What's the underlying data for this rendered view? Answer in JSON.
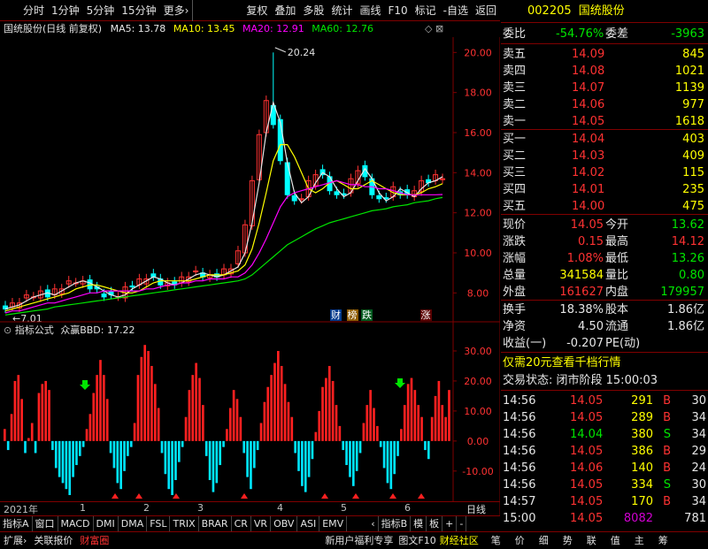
{
  "toolbar": {
    "items": [
      "分时",
      "1分钟",
      "5分钟",
      "15分钟",
      "更多›",
      "复权",
      "叠加",
      "多股",
      "统计",
      "画线",
      "F10",
      "标记",
      "-自选",
      "返回"
    ]
  },
  "main_chart": {
    "title": "国统股份(日线 前复权)",
    "ma5": "MA5: 13.78",
    "ma10": "MA10: 13.45",
    "ma20": "MA20: 12.91",
    "ma60": "MA60: 12.76",
    "y_ticks": [
      "20.00",
      "18.00",
      "16.00",
      "14.00",
      "12.00",
      "10.00",
      "8.00"
    ],
    "high_label": "20.24",
    "low_label": "7.01",
    "markers": [
      "财",
      "榜",
      "跌",
      "涨"
    ]
  },
  "indicator": {
    "name": "指标公式",
    "formula": "众赢BBD: 17.22",
    "y_ticks": [
      "30.00",
      "20.00",
      "10.00",
      "0.00",
      "-10.00"
    ]
  },
  "timeline": {
    "year": "2021年",
    "months": [
      "1",
      "2",
      "3",
      "4",
      "5",
      "6"
    ],
    "right": "日线"
  },
  "bottom_tabs": [
    "指标A",
    "窗口",
    "MACD",
    "DMI",
    "DMA",
    "FSL",
    "TRIX",
    "BRAR",
    "CR",
    "VR",
    "OBV",
    "ASI",
    "EMV",
    "‹",
    "指标B",
    "模",
    "板",
    "+",
    "-"
  ],
  "status_left": [
    "扩展›",
    "关联报价",
    "财富圈"
  ],
  "status_mid": [
    "新用户福利专享",
    "图文F10",
    "财经社区"
  ],
  "status_right": [
    "笔",
    "价",
    "细",
    "势",
    "联",
    "值",
    "主",
    "筹"
  ],
  "quote": {
    "code": "002205",
    "name": "国统股份",
    "weibi_label": "委比",
    "weibi": "-54.76%",
    "weicha_label": "委差",
    "weicha": "-3963",
    "asks": [
      {
        "label": "卖五",
        "price": "14.09",
        "vol": "845"
      },
      {
        "label": "卖四",
        "price": "14.08",
        "vol": "1021"
      },
      {
        "label": "卖三",
        "price": "14.07",
        "vol": "1139"
      },
      {
        "label": "卖二",
        "price": "14.06",
        "vol": "977"
      },
      {
        "label": "卖一",
        "price": "14.05",
        "vol": "1618"
      }
    ],
    "bids": [
      {
        "label": "买一",
        "price": "14.04",
        "vol": "403"
      },
      {
        "label": "买二",
        "price": "14.03",
        "vol": "409"
      },
      {
        "label": "买三",
        "price": "14.02",
        "vol": "115"
      },
      {
        "label": "买四",
        "price": "14.01",
        "vol": "235"
      },
      {
        "label": "买五",
        "price": "14.00",
        "vol": "475"
      }
    ],
    "stats": [
      {
        "l1": "现价",
        "v1": "14.05",
        "l2": "今开",
        "v2": "13.62"
      },
      {
        "l1": "涨跌",
        "v1": "0.15",
        "l2": "最高",
        "v2": "14.12"
      },
      {
        "l1": "涨幅",
        "v1": "1.08%",
        "l2": "最低",
        "v2": "13.26"
      },
      {
        "l1": "总量",
        "v1": "341584",
        "l2": "量比",
        "v2": "0.80"
      },
      {
        "l1": "外盘",
        "v1": "161627",
        "l2": "内盘",
        "v2": "179957"
      }
    ],
    "stats2": [
      {
        "l1": "换手",
        "v1": "18.38%",
        "l2": "股本",
        "v2": "1.86亿"
      },
      {
        "l1": "净资",
        "v1": "4.50",
        "l2": "流通",
        "v2": "1.86亿"
      },
      {
        "l1": "收益(一)",
        "v1": "-0.207",
        "l2": "PE(动)",
        "v2": ""
      }
    ],
    "promo": "仅需20元查看千档行情",
    "trade_status": "交易状态: 闭市阶段 15:00:03",
    "ticks": [
      {
        "t": "14:56",
        "p": "14.05",
        "v": "291",
        "d": "B",
        "n": "30"
      },
      {
        "t": "14:56",
        "p": "14.05",
        "v": "289",
        "d": "B",
        "n": "34"
      },
      {
        "t": "14:56",
        "p": "14.04",
        "v": "380",
        "d": "S",
        "n": "34"
      },
      {
        "t": "14:56",
        "p": "14.05",
        "v": "386",
        "d": "B",
        "n": "29"
      },
      {
        "t": "14:56",
        "p": "14.06",
        "v": "140",
        "d": "B",
        "n": "24"
      },
      {
        "t": "14:56",
        "p": "14.05",
        "v": "334",
        "d": "S",
        "n": "30"
      },
      {
        "t": "14:57",
        "p": "14.05",
        "v": "170",
        "d": "B",
        "n": "34"
      },
      {
        "t": "15:00",
        "p": "14.05",
        "v": "8082",
        "d": "",
        "n": "781"
      }
    ]
  },
  "chart_data": {
    "type": "candlestick",
    "price_ylim": [
      7.0,
      20.5
    ],
    "ma5": [
      7.2,
      7.3,
      7.4,
      7.6,
      7.8,
      7.9,
      8.0,
      7.9,
      8.1,
      8.3,
      8.5,
      8.6,
      8.5,
      8.3,
      8.1,
      7.9,
      7.8,
      7.9,
      8.2,
      8.4,
      8.6,
      8.8,
      8.7,
      8.5,
      8.4,
      8.5,
      8.7,
      8.9,
      9.0,
      8.9,
      8.8,
      8.9,
      9.1,
      9.3,
      10.0,
      11.5,
      13.5,
      16.0,
      17.5,
      16.5,
      14.5,
      13.0,
      12.5,
      12.8,
      13.5,
      14.0,
      13.8,
      13.2,
      12.8,
      13.0,
      13.6,
      14.2,
      13.7,
      13.0,
      12.6,
      12.8,
      13.2,
      13.0,
      12.8,
      13.2,
      13.5,
      13.6,
      13.8
    ],
    "ma10": [
      7.1,
      7.2,
      7.3,
      7.4,
      7.5,
      7.6,
      7.7,
      7.8,
      7.9,
      8.0,
      8.2,
      8.3,
      8.4,
      8.4,
      8.3,
      8.2,
      8.1,
      8.0,
      8.0,
      8.1,
      8.3,
      8.5,
      8.6,
      8.6,
      8.6,
      8.6,
      8.6,
      8.7,
      8.8,
      8.9,
      8.9,
      8.9,
      9.0,
      9.1,
      9.4,
      10.2,
      11.5,
      13.0,
      14.6,
      15.4,
      15.4,
      14.8,
      14.0,
      13.2,
      13.0,
      13.2,
      13.5,
      13.6,
      13.4,
      13.2,
      13.2,
      13.4,
      13.6,
      13.4,
      13.2,
      13.0,
      12.9,
      12.9,
      12.9,
      13.0,
      13.2,
      13.3,
      13.45
    ],
    "ma20": [
      7.0,
      7.1,
      7.1,
      7.2,
      7.3,
      7.4,
      7.5,
      7.5,
      7.6,
      7.7,
      7.8,
      7.9,
      8.0,
      8.0,
      8.1,
      8.1,
      8.1,
      8.1,
      8.1,
      8.1,
      8.2,
      8.2,
      8.3,
      8.4,
      8.4,
      8.5,
      8.5,
      8.6,
      8.6,
      8.7,
      8.7,
      8.7,
      8.8,
      8.8,
      9.0,
      9.4,
      10.0,
      10.7,
      11.5,
      12.3,
      12.8,
      13.0,
      13.1,
      13.2,
      13.3,
      13.4,
      13.5,
      13.6,
      13.5,
      13.4,
      13.4,
      13.3,
      13.3,
      13.2,
      13.2,
      13.1,
      13.0,
      12.9,
      12.9,
      12.9,
      12.9,
      12.9,
      12.91
    ],
    "ma60": [
      6.9,
      6.95,
      7.0,
      7.05,
      7.1,
      7.15,
      7.2,
      7.3,
      7.35,
      7.4,
      7.45,
      7.5,
      7.55,
      7.6,
      7.65,
      7.7,
      7.75,
      7.8,
      7.85,
      7.9,
      7.95,
      8.0,
      8.05,
      8.1,
      8.15,
      8.2,
      8.25,
      8.3,
      8.35,
      8.4,
      8.45,
      8.5,
      8.55,
      8.6,
      8.7,
      8.9,
      9.2,
      9.5,
      9.8,
      10.1,
      10.4,
      10.6,
      10.8,
      11.0,
      11.2,
      11.35,
      11.5,
      11.6,
      11.7,
      11.8,
      11.9,
      12.0,
      12.1,
      12.15,
      12.2,
      12.3,
      12.35,
      12.4,
      12.5,
      12.55,
      12.6,
      12.7,
      12.76
    ],
    "bbd_ylim": [
      -18,
      35
    ],
    "bbd": [
      4,
      -3,
      9,
      20,
      22,
      14,
      -4,
      1,
      6,
      -4,
      16,
      19,
      20,
      17,
      -3,
      -9,
      -12,
      -14,
      -16,
      -18,
      -12,
      -8,
      -5,
      -2,
      4,
      9,
      16,
      22,
      27,
      22,
      14,
      -4,
      -9,
      -14,
      -16,
      -10,
      -5,
      -2,
      6,
      22,
      28,
      32,
      30,
      25,
      19,
      11,
      -4,
      -11,
      -16,
      -18,
      -13,
      -7,
      -2,
      8,
      17,
      22,
      26,
      21,
      12,
      -5,
      -13,
      -17,
      -14,
      -8,
      -2,
      4,
      11,
      17,
      14,
      8,
      -4,
      -12,
      -16,
      -9,
      -3,
      6,
      13,
      18,
      22,
      26,
      30,
      25,
      19,
      13,
      8,
      -4,
      -10,
      -15,
      -17,
      -12,
      -6,
      3,
      10,
      18,
      21,
      25,
      20,
      12,
      5,
      -3,
      -8,
      -12,
      -15,
      -10,
      -4,
      6,
      12,
      17,
      11,
      5,
      -2,
      -9,
      -14,
      -16,
      -11,
      -5,
      4,
      12,
      19,
      21,
      17,
      12,
      8,
      -3,
      -6,
      8,
      15,
      20,
      12,
      8,
      17
    ]
  }
}
